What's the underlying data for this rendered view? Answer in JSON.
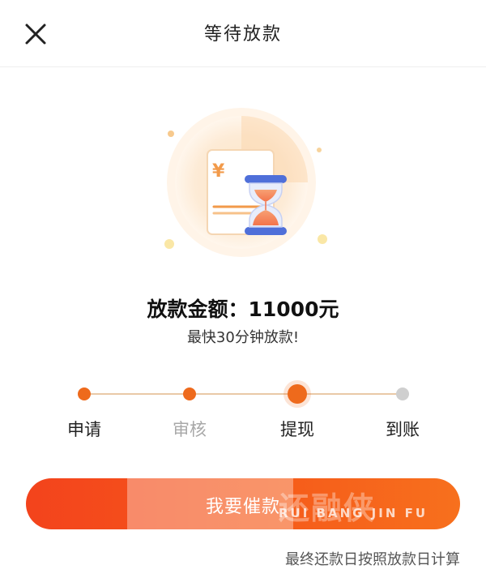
{
  "header": {
    "title": "等待放款",
    "close_icon": "close-icon"
  },
  "loan": {
    "amount_text": "放款金额：11000元",
    "fast_note": "最快30分钟放款!"
  },
  "progress": {
    "steps": [
      {
        "label": "申请",
        "state": "done"
      },
      {
        "label": "审核",
        "state": "done"
      },
      {
        "label": "提现",
        "state": "current"
      },
      {
        "label": "到账",
        "state": "pending"
      }
    ]
  },
  "actions": {
    "urge_label": "我要催款"
  },
  "watermark": {
    "chars": "还融侠",
    "sub": "RUI BANG JIN FU"
  },
  "footnote": "最终还款日按照放款日计算",
  "colors": {
    "accent": "#ee6a1c",
    "button_start": "#f3431c",
    "button_end": "#f7701d",
    "track": "#e9c9a7",
    "pending_dot": "#cfcfcf"
  }
}
